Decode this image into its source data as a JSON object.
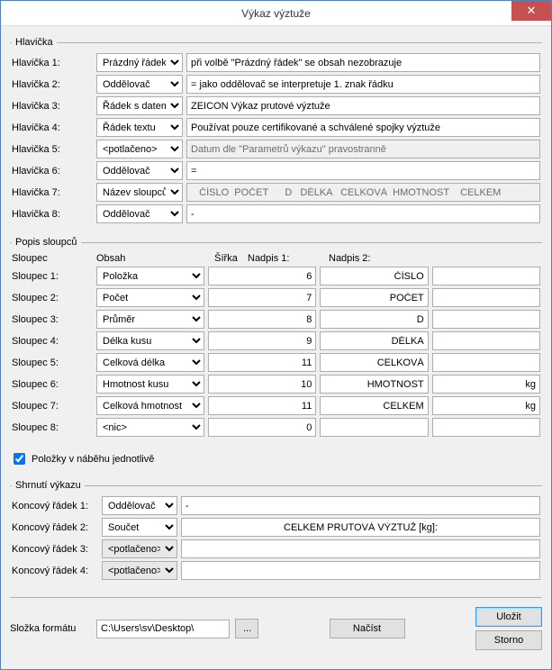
{
  "title": "Výkaz výztuže",
  "sections": {
    "header": "Hlavička",
    "columns": "Popis sloupců",
    "summary": "Shrnutí výkazu"
  },
  "headerRows": {
    "labels": [
      "Hlavička 1:",
      "Hlavička 2:",
      "Hlavička 3:",
      "Hlavička 4:",
      "Hlavička 5:",
      "Hlavička 6:",
      "Hlavička 7:",
      "Hlavička 8:"
    ],
    "selects": [
      "Prázdný řádek",
      "Oddělovač",
      "Řádek s datem",
      "Řádek textu",
      "<potlačeno>",
      "Oddělovač",
      "Název sloupců",
      "Oddělovač"
    ],
    "values": [
      "při volbě \"Prázdný řádek\" se obsah nezobrazuje",
      "= jako oddělovač se interpretuje 1. znak řádku",
      "ZEICON Výkaz prutové výztuže",
      "Používat pouze certifikované a schválené spojky výztuže",
      "Datum dle \"Parametrů výkazu\" pravostranně",
      "=",
      "   ČÍSLO  POČET      D   DÉLKA   CELKOVÁ  HMOTNOST    CELKEM",
      "-"
    ],
    "readonly": [
      false,
      false,
      false,
      false,
      true,
      false,
      true,
      false
    ]
  },
  "columnHeaders": {
    "c0": "Sloupec",
    "c1": "Obsah",
    "c2": "Šířka",
    "c3": "Nadpis 1:",
    "c4": "Nadpis 2:"
  },
  "columnRows": {
    "labels": [
      "Sloupec 1:",
      "Sloupec 2:",
      "Sloupec 3:",
      "Sloupec 4:",
      "Sloupec 5:",
      "Sloupec 6:",
      "Sloupec 7:",
      "Sloupec 8:"
    ],
    "obsah": [
      "Položka",
      "Počet",
      "Průměr",
      "Délka kusu",
      "Celková délka",
      "Hmotnost kusu",
      "Celková hmotnost",
      "<nic>"
    ],
    "sirka": [
      "6",
      "7",
      "8",
      "9",
      "11",
      "10",
      "11",
      "0"
    ],
    "nadpis1": [
      "ČÍSLO",
      "POČET",
      "D",
      "DÉLKA",
      "CELKOVÁ",
      "HMOTNOST",
      "CELKEM",
      ""
    ],
    "nadpis2": [
      "",
      "",
      "",
      "",
      "",
      "kg",
      "kg",
      ""
    ]
  },
  "checkbox": {
    "label": "Položky v náběhu jednotlivě",
    "checked": true
  },
  "summaryRows": {
    "labels": [
      "Koncový řádek 1:",
      "Koncový řádek 2:",
      "Koncový řádek 3:",
      "Koncový řádek 4:"
    ],
    "selects": [
      "Oddělovač",
      "Součet",
      "<potlačeno>",
      "<potlačeno>"
    ],
    "values": [
      "-",
      "CELKEM PRUTOVÁ VÝZTUŽ [kg]:",
      "",
      ""
    ],
    "centered": [
      false,
      true,
      false,
      false
    ],
    "suppressed": [
      false,
      false,
      true,
      true
    ]
  },
  "footer": {
    "label": "Složka formátu",
    "path": "C:\\Users\\sv\\Desktop\\",
    "browse": "...",
    "load": "Načíst",
    "save": "Uložit",
    "cancel": "Storno"
  }
}
